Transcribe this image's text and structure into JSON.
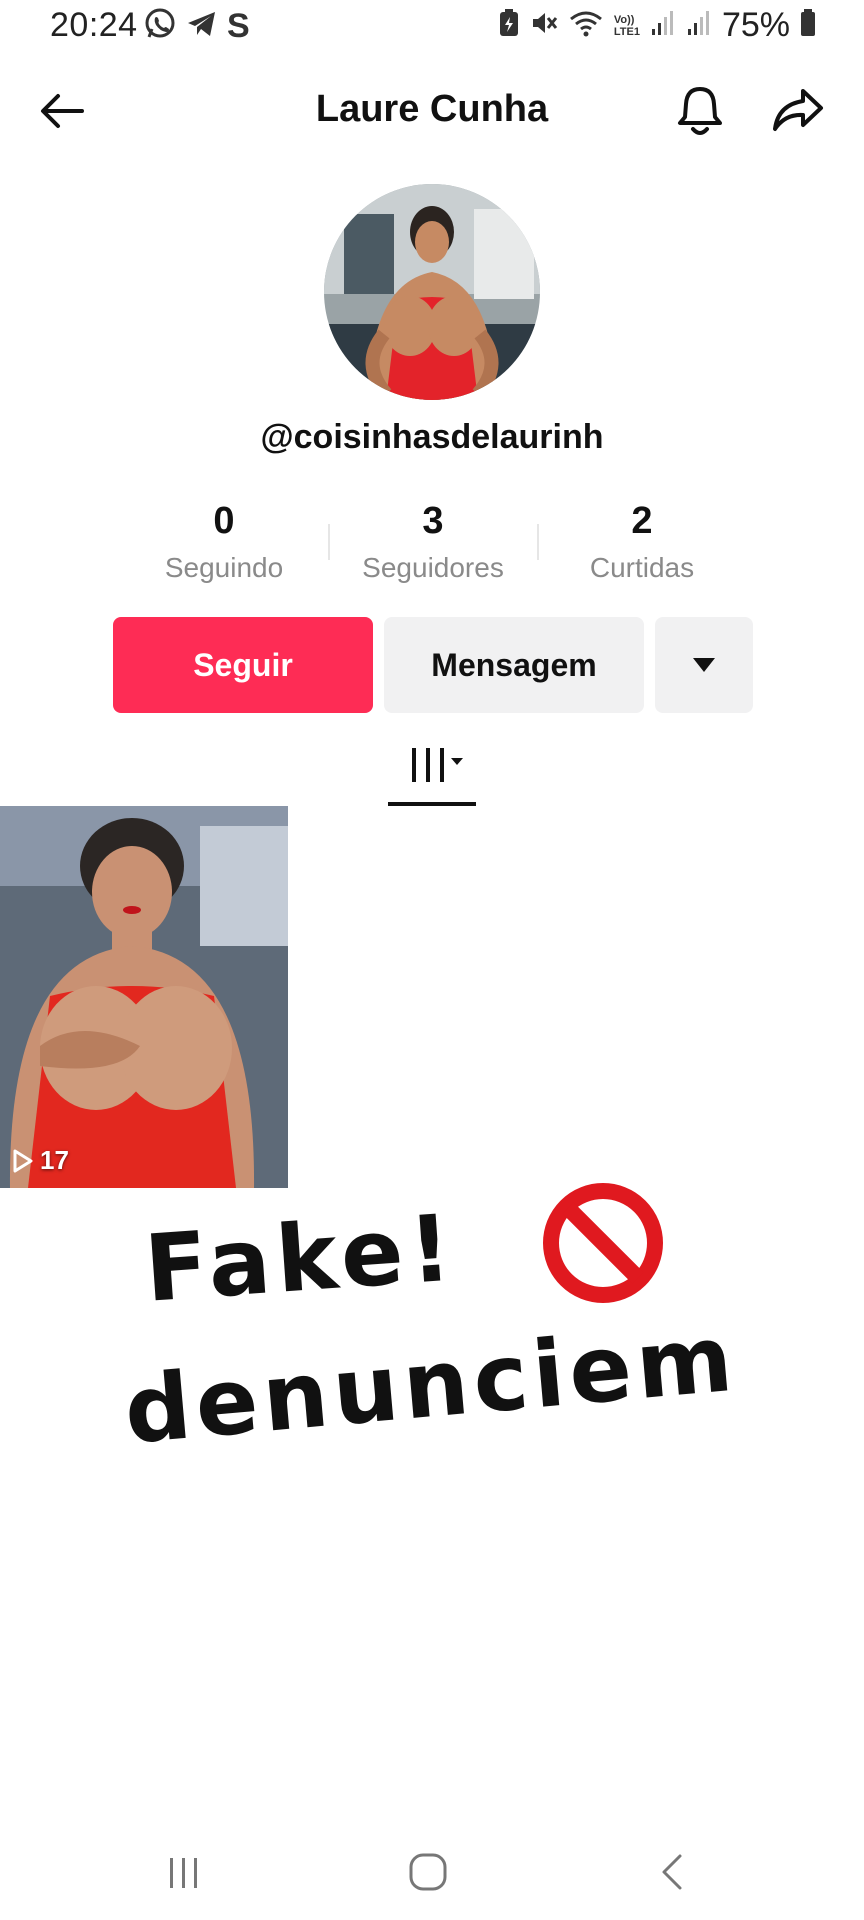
{
  "status_bar": {
    "time": "20:24",
    "battery": "75%",
    "app_icons": [
      "whatsapp-icon",
      "telegram-icon",
      "s-app-icon"
    ],
    "system_icons": [
      "battery-saver-icon",
      "mute-icon",
      "wifi-icon",
      "volte-icon",
      "signal-icon",
      "signal-icon",
      "battery-icon"
    ],
    "volte_label_top": "Vo))",
    "volte_label_bottom": "LTE1",
    "s_app_letter": "S"
  },
  "header": {
    "title": "Laure Cunha"
  },
  "profile": {
    "username": "@coisinhasdelaurinh",
    "stats": [
      {
        "value": "0",
        "label": "Seguindo"
      },
      {
        "value": "3",
        "label": "Seguidores"
      },
      {
        "value": "2",
        "label": "Curtidas"
      }
    ]
  },
  "actions": {
    "follow_label": "Seguir",
    "message_label": "Mensagem"
  },
  "videos": [
    {
      "views": "17"
    }
  ],
  "overlay": {
    "line1": "Fake!",
    "line2": "denunciem"
  },
  "colors": {
    "accent": "#fe2c55",
    "button_grey": "#f1f1f2",
    "muted_text": "#8a8a8a",
    "no_sign_red": "#e0191f"
  }
}
